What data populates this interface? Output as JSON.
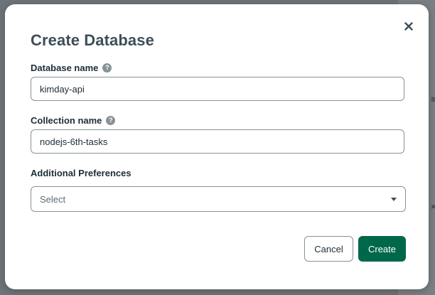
{
  "modal": {
    "title": "Create Database",
    "close_icon": "close-icon"
  },
  "fields": {
    "database_name": {
      "label": "Database name",
      "value": "kimday-api",
      "help_icon": "help-icon"
    },
    "collection_name": {
      "label": "Collection name",
      "value": "nodejs-6th-tasks",
      "help_icon": "help-icon"
    },
    "additional_preferences": {
      "label": "Additional Preferences",
      "selected": "Select"
    }
  },
  "buttons": {
    "cancel_label": "Cancel",
    "create_label": "Create"
  },
  "colors": {
    "primary": "#00684a",
    "title": "#3d4f58",
    "border": "#889397",
    "backdrop": "#6e7377"
  }
}
